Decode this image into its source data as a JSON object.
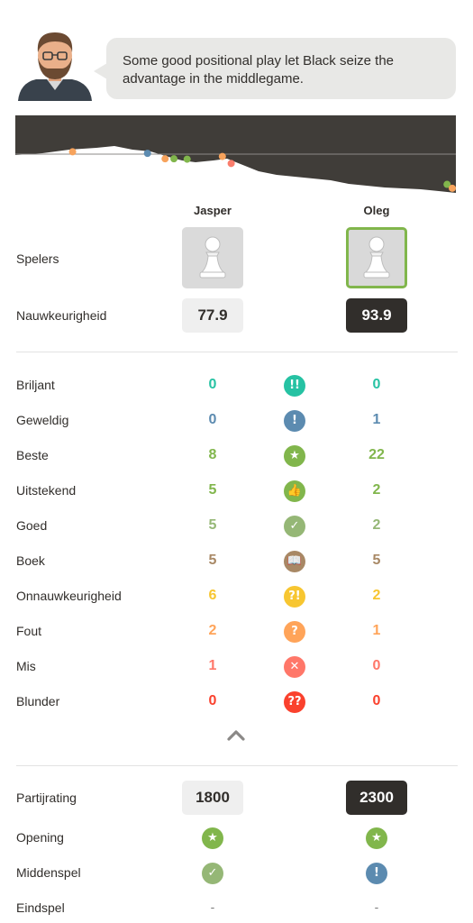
{
  "coach": {
    "message": "Some good positional play let Black seize the advantage in the middlegame."
  },
  "graph": {
    "markers": [
      {
        "position": 0.13,
        "advantage": 0.06,
        "color": "#f7a35c"
      },
      {
        "position": 0.3,
        "advantage": 0.02,
        "color": "#5c8bb0"
      },
      {
        "position": 0.34,
        "advantage": -0.12,
        "color": "#f7a35c"
      },
      {
        "position": 0.36,
        "advantage": -0.12,
        "color": "#81b64c"
      },
      {
        "position": 0.39,
        "advantage": -0.13,
        "color": "#81b64c"
      },
      {
        "position": 0.47,
        "advantage": -0.06,
        "color": "#f7a35c"
      },
      {
        "position": 0.49,
        "advantage": -0.24,
        "color": "#fa7d6c"
      },
      {
        "position": 0.98,
        "advantage": -0.78,
        "color": "#81b64c"
      },
      {
        "position": 1.0,
        "advantage": -0.88,
        "color": "#f7a35c"
      }
    ]
  },
  "players": {
    "white_name": "Jasper",
    "black_name": "Oleg",
    "label": "Spelers"
  },
  "accuracy": {
    "label": "Nauwkeurigheid",
    "white": "77.9",
    "black": "93.9"
  },
  "classifications": [
    {
      "label": "Briljant",
      "white": "0",
      "black": "0",
      "color": "#26c2a3",
      "icon": "brilliant-icon",
      "glyph": "!!"
    },
    {
      "label": "Geweldig",
      "white": "0",
      "black": "1",
      "color": "#5c8bb0",
      "icon": "great-icon",
      "glyph": "!"
    },
    {
      "label": "Beste",
      "white": "8",
      "black": "22",
      "color": "#81b64c",
      "icon": "best-icon",
      "glyph": "★"
    },
    {
      "label": "Uitstekend",
      "white": "5",
      "black": "2",
      "color": "#81b64c",
      "icon": "excellent-icon",
      "glyph": "👍"
    },
    {
      "label": "Goed",
      "white": "5",
      "black": "2",
      "color": "#95b776",
      "icon": "good-icon",
      "glyph": "✓"
    },
    {
      "label": "Boek",
      "white": "5",
      "black": "5",
      "color": "#a88865",
      "icon": "book-icon",
      "glyph": "📖"
    },
    {
      "label": "Onnauwkeurigheid",
      "white": "6",
      "black": "2",
      "color": "#f7c631",
      "icon": "inaccuracy-icon",
      "glyph": "?!"
    },
    {
      "label": "Fout",
      "white": "2",
      "black": "1",
      "color": "#ffa459",
      "icon": "mistake-icon",
      "glyph": "?"
    },
    {
      "label": "Mis",
      "white": "1",
      "black": "0",
      "color": "#ff7769",
      "icon": "miss-icon",
      "glyph": "✕"
    },
    {
      "label": "Blunder",
      "white": "0",
      "black": "0",
      "color": "#fa412d",
      "icon": "blunder-icon",
      "glyph": "??"
    }
  ],
  "game_rating": {
    "label": "Partijrating",
    "white": "1800",
    "black": "2300"
  },
  "phases": [
    {
      "label": "Opening",
      "white_icon": "best-icon",
      "black_icon": "best-icon"
    },
    {
      "label": "Middenspel",
      "white_icon": "good-icon",
      "black_icon": "great-icon"
    },
    {
      "label": "Eindspel",
      "white": "-",
      "black": "-"
    }
  ]
}
